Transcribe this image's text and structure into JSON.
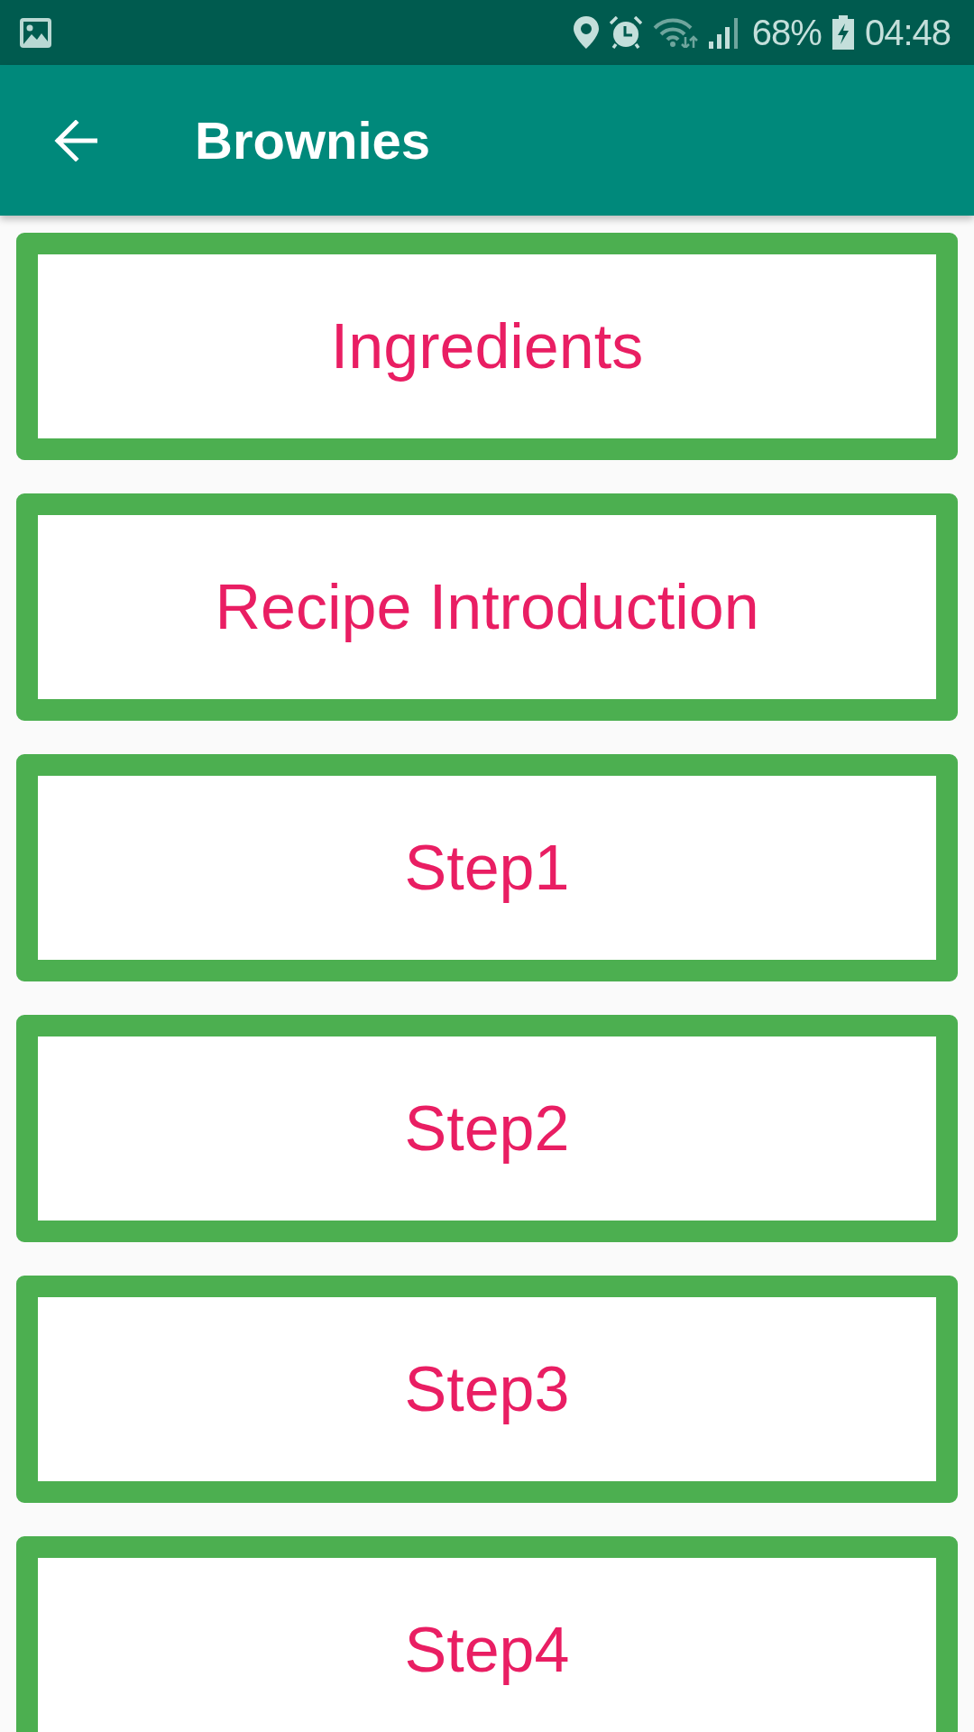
{
  "status_bar": {
    "battery": "68%",
    "time": "04:48"
  },
  "app_bar": {
    "title": "Brownies"
  },
  "sections": [
    {
      "label": "Ingredients"
    },
    {
      "label": "Recipe Introduction"
    },
    {
      "label": "Step1"
    },
    {
      "label": "Step2"
    },
    {
      "label": "Step3"
    },
    {
      "label": "Step4"
    }
  ]
}
